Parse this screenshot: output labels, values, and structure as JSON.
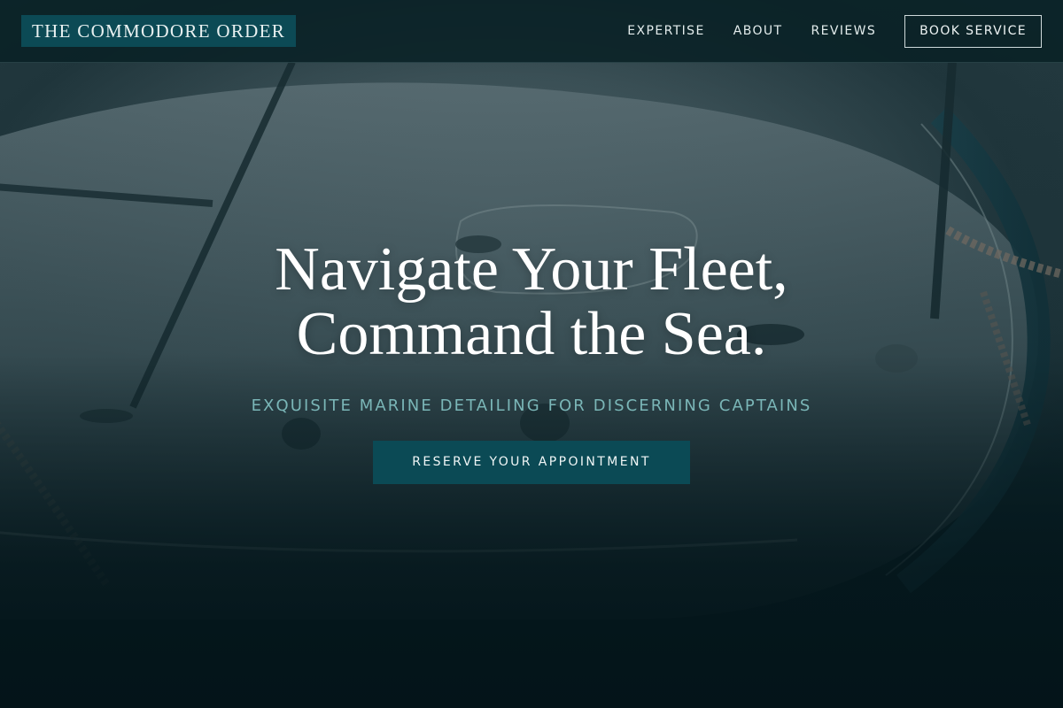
{
  "header": {
    "logo": "THE COMMODORE ORDER",
    "nav": {
      "expertise": "EXPERTISE",
      "about": "ABOUT",
      "reviews": "REVIEWS"
    },
    "book_button": "BOOK SERVICE"
  },
  "hero": {
    "title_line1": "Navigate Your Fleet,",
    "title_line2": "Command the Sea.",
    "subtitle": "EXQUISITE MARINE DETAILING FOR DISCERNING CAPTAINS",
    "cta": "RESERVE YOUR APPOINTMENT"
  },
  "colors": {
    "brand_teal": "#0c4a55",
    "subtitle_teal": "#7ab6b7",
    "header_bg": "#092126"
  }
}
